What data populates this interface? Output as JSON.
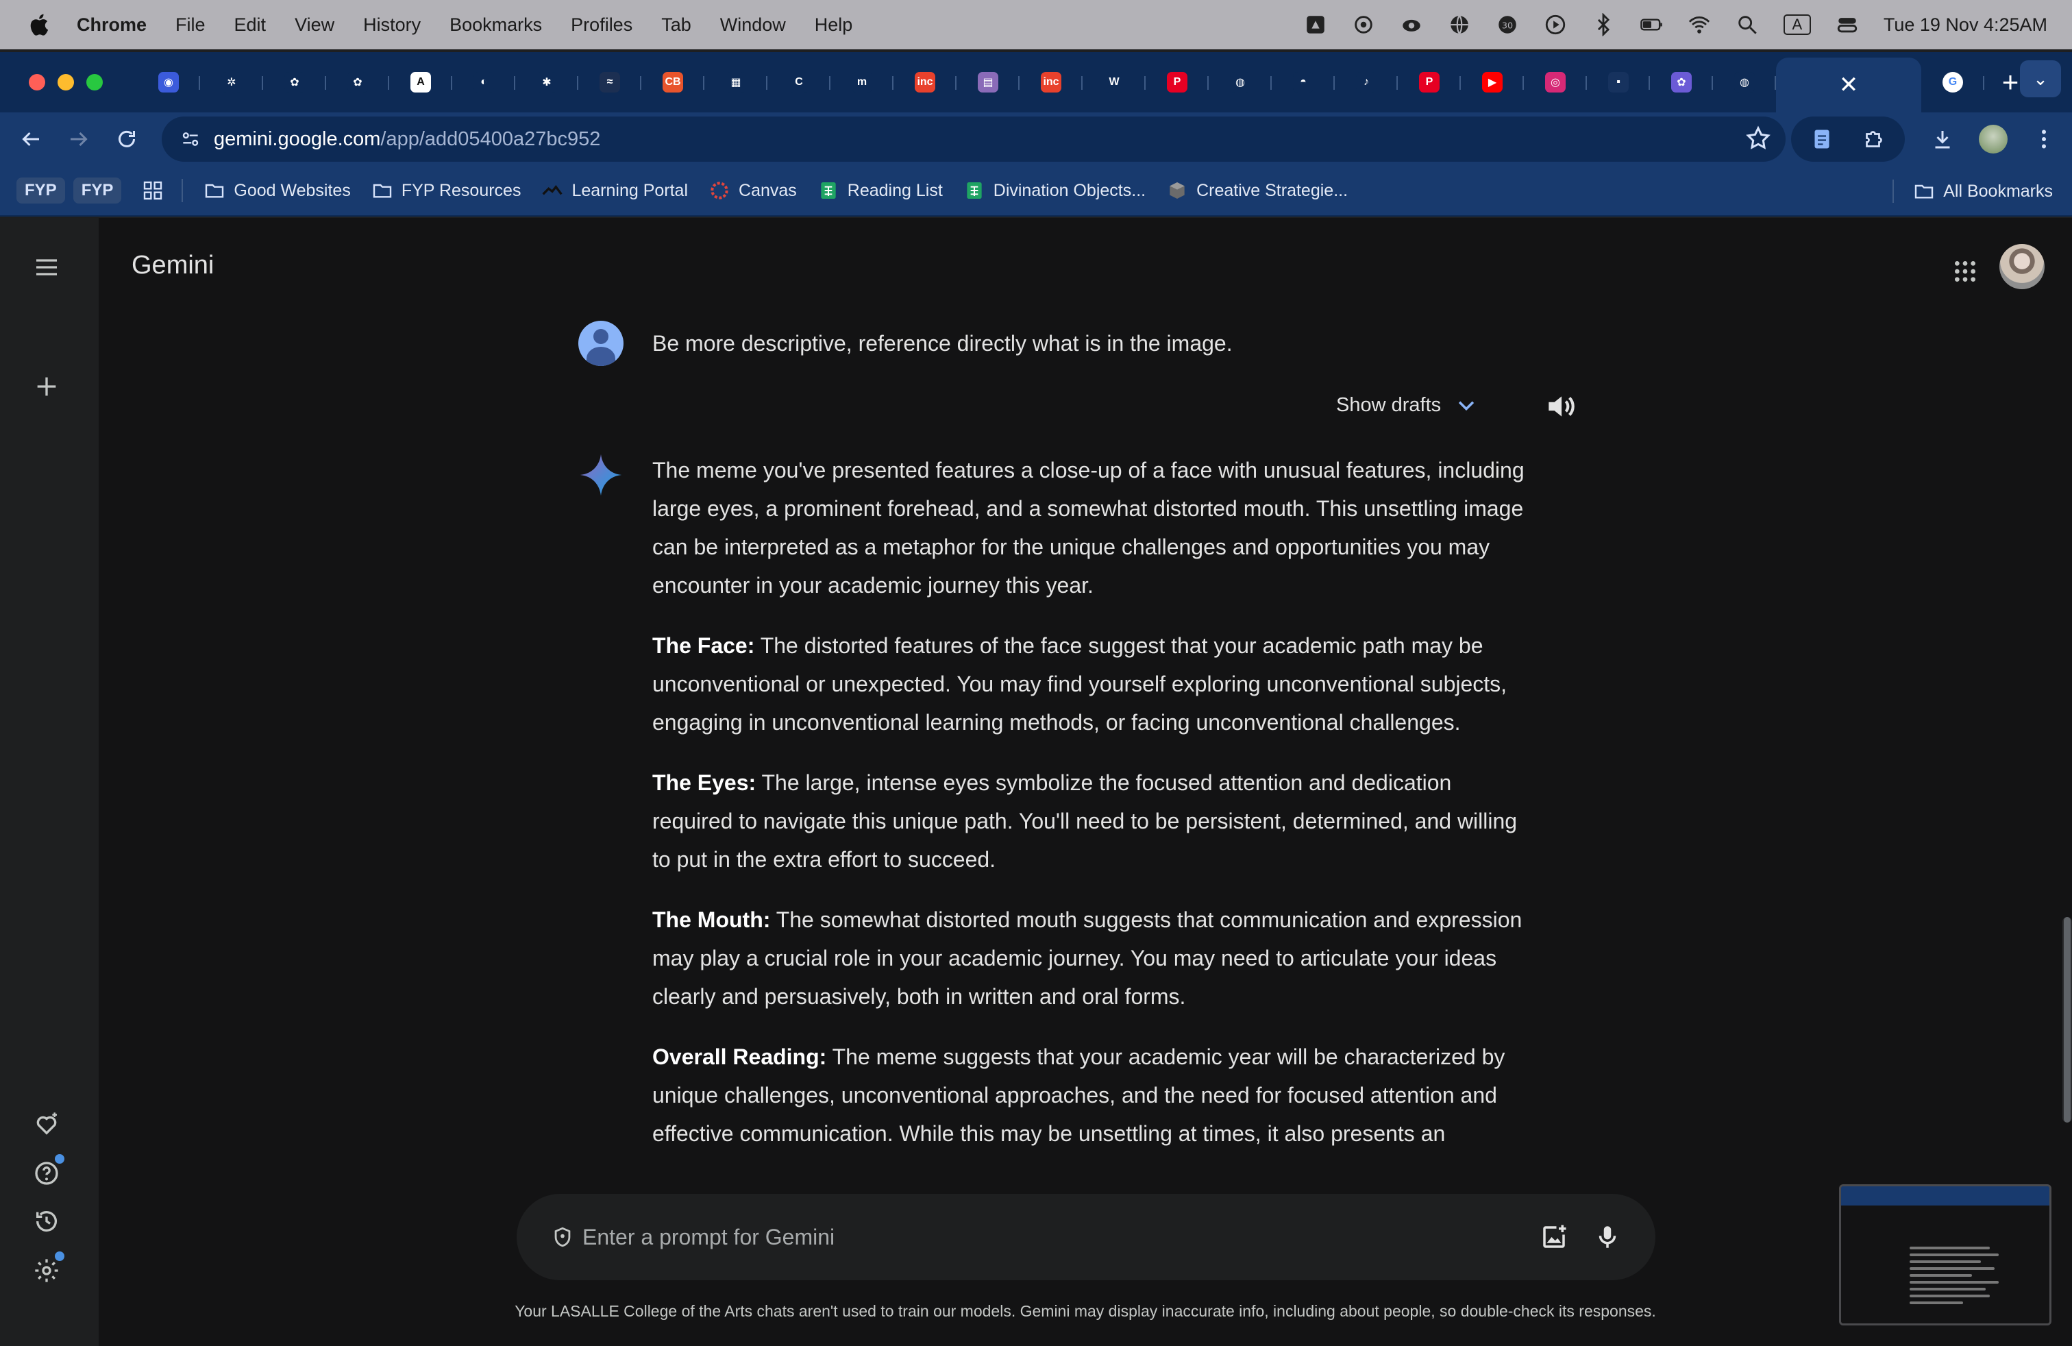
{
  "menubar": {
    "app_name": "Chrome",
    "items": [
      "File",
      "Edit",
      "View",
      "History",
      "Bookmarks",
      "Profiles",
      "Tab",
      "Window",
      "Help"
    ],
    "clock": "Tue 19 Nov  4:25AM",
    "keyboard_indicator": "A"
  },
  "tabs": {
    "pinned_favicons": [
      {
        "icon": "globe-blue-icon",
        "color": "#3b5bdb",
        "glyph": "◉"
      },
      {
        "icon": "asterisk-icon",
        "color": "#0d2a55",
        "glyph": "✲"
      },
      {
        "icon": "openai-icon",
        "color": "#0d2a55",
        "glyph": "✿"
      },
      {
        "icon": "openai-icon",
        "color": "#0d2a55",
        "glyph": "✿"
      },
      {
        "icon": "letter-a-icon",
        "color": "#ffffff",
        "glyph": "A"
      },
      {
        "icon": "eye-icon",
        "color": "#0d2a55",
        "glyph": "◐"
      },
      {
        "icon": "double-asterisk-icon",
        "color": "#0d2a55",
        "glyph": "✱"
      },
      {
        "icon": "dark-logo-icon",
        "color": "#1c2f52",
        "glyph": "≈"
      },
      {
        "icon": "cb-logo-icon",
        "color": "#e8542c",
        "glyph": "CB"
      },
      {
        "icon": "strip-logo-icon",
        "color": "#0d2a55",
        "glyph": "▦"
      },
      {
        "icon": "letter-c-icon",
        "color": "#0d2a55",
        "glyph": "C"
      },
      {
        "icon": "letter-m-icon",
        "color": "#0d2a55",
        "glyph": "m"
      },
      {
        "icon": "inc-logo-icon",
        "color": "#e8412c",
        "glyph": "inc"
      },
      {
        "icon": "gradient-icon",
        "color": "#8a6bb8",
        "glyph": "▤"
      },
      {
        "icon": "inc-logo-icon",
        "color": "#e8412c",
        "glyph": "inc"
      },
      {
        "icon": "wordpress-icon",
        "color": "#0d2a55",
        "glyph": "W"
      },
      {
        "icon": "pinterest-icon",
        "color": "#e60023",
        "glyph": "P"
      },
      {
        "icon": "globe-icon",
        "color": "#0d2a55",
        "glyph": "◍"
      },
      {
        "icon": "github-icon",
        "color": "#0d2a55",
        "glyph": "◓"
      },
      {
        "icon": "tiktok-icon",
        "color": "#0d2a55",
        "glyph": "♪"
      },
      {
        "icon": "pinterest-icon",
        "color": "#e60023",
        "glyph": "P"
      },
      {
        "icon": "youtube-icon",
        "color": "#ff0000",
        "glyph": "▶"
      },
      {
        "icon": "instagram-icon",
        "color": "#d62976",
        "glyph": "◎"
      },
      {
        "icon": "dark-square-icon",
        "color": "#16325e",
        "glyph": "▪"
      },
      {
        "icon": "openai-purple-icon",
        "color": "#6b5bd6",
        "glyph": "✿"
      },
      {
        "icon": "globe-icon",
        "color": "#0d2a55",
        "glyph": "◍"
      }
    ],
    "active_tab_close": "✕",
    "google_tab_glyph": "G",
    "new_tab": "+",
    "tab_search": "⌄"
  },
  "toolbar": {
    "url_host": "gemini.google.com",
    "url_path": "/app/add05400a27bc952"
  },
  "bookmarks": {
    "chips": [
      "FYP",
      "FYP"
    ],
    "items": [
      {
        "label": "Good Websites",
        "icon": "folder-icon"
      },
      {
        "label": "FYP Resources",
        "icon": "folder-icon"
      },
      {
        "label": "Learning Portal",
        "icon": "portal-icon"
      },
      {
        "label": "Canvas",
        "icon": "canvas-icon"
      },
      {
        "label": "Reading List",
        "icon": "sheets-icon"
      },
      {
        "label": "Divination Objects...",
        "icon": "sheets-icon"
      },
      {
        "label": "Creative Strategie...",
        "icon": "cube-icon"
      }
    ],
    "all_bookmarks": "All Bookmarks"
  },
  "gemini": {
    "title": "Gemini",
    "user_message": "Be more descriptive, reference directly what is in the image.",
    "show_drafts": "Show drafts",
    "response": {
      "intro": "The meme you've presented features a close-up of a face with unusual features, including large eyes, a prominent forehead, and a somewhat distorted mouth. This unsettling image can be interpreted as a metaphor for the unique challenges and opportunities you may encounter in your academic journey this year.",
      "sections": [
        {
          "heading": "The Face:",
          "text": " The distorted features of the face suggest that your academic path may be unconventional or unexpected. You may find yourself exploring unconventional subjects, engaging in unconventional learning methods, or facing unconventional challenges."
        },
        {
          "heading": "The Eyes:",
          "text": " The large, intense eyes symbolize the focused attention and dedication required to navigate this unique path. You'll need to be persistent, determined, and willing to put in the extra effort to succeed."
        },
        {
          "heading": "The Mouth:",
          "text": " The somewhat distorted mouth suggests that communication and expression may play a crucial role in your academic journey. You may need to articulate your ideas clearly and persuasively, both in written and oral forms."
        },
        {
          "heading": "Overall Reading:",
          "text": " The meme suggests that your academic year will be characterized by unique challenges, unconventional approaches, and the need for focused attention and effective communication. While this may be unsettling at times, it also presents an"
        }
      ]
    },
    "prompt_placeholder": "Enter a prompt for Gemini",
    "disclaimer": "Your LASALLE College of the Arts chats aren't used to train our models. Gemini may display inaccurate info, including about people, so double-check its responses."
  },
  "colors": {
    "accent": "#8ab4f8",
    "traffic_red": "#ff5f57",
    "traffic_yellow": "#febc2e",
    "traffic_green": "#28c840"
  }
}
